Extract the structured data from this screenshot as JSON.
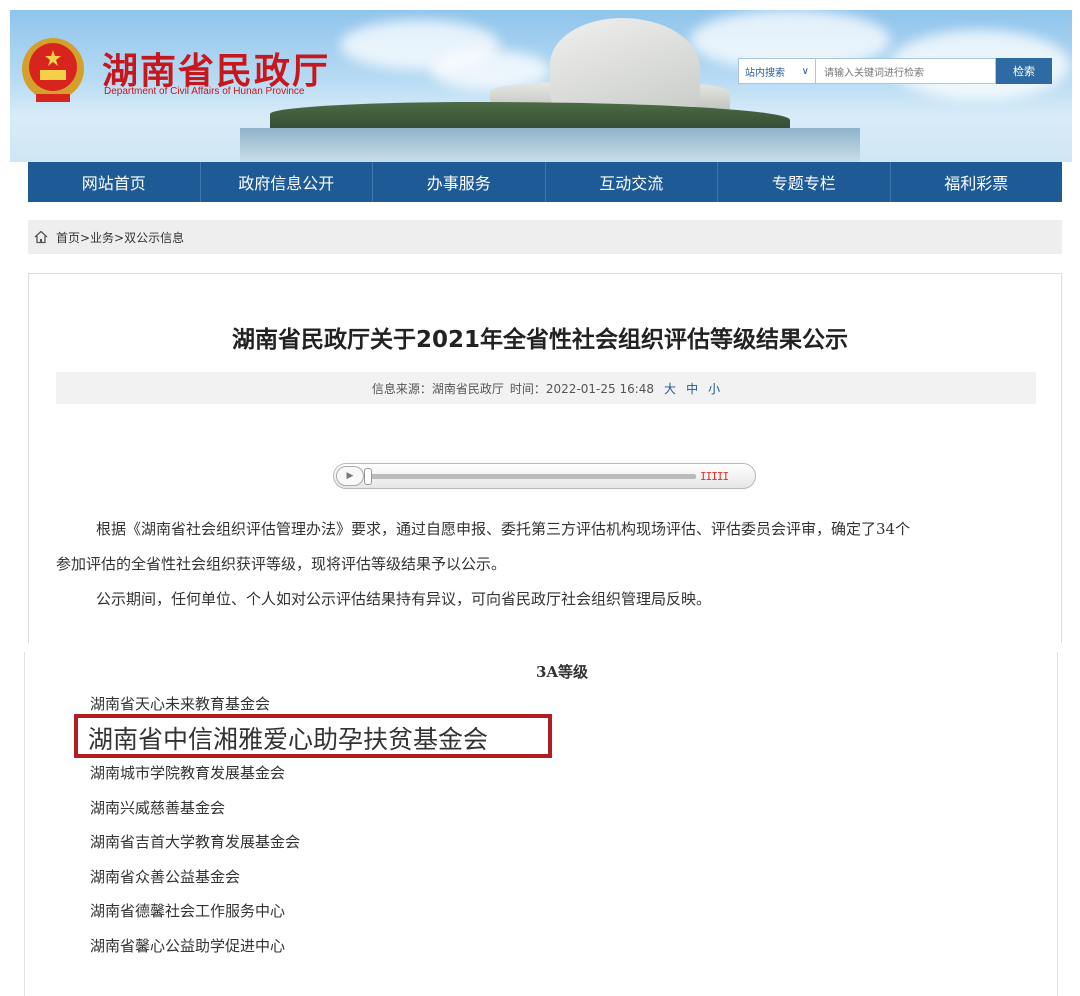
{
  "header": {
    "site_title": "湖南省民政厅",
    "site_subtitle": "Department of Civil Affairs of Hunan Province",
    "search": {
      "scope": "站内搜索",
      "placeholder": "请输入关键词进行检索",
      "button": "检索"
    }
  },
  "nav": {
    "items": [
      "网站首页",
      "政府信息公开",
      "办事服务",
      "互动交流",
      "专题专栏",
      "福利彩票"
    ]
  },
  "breadcrumb": "首页>业务>双公示信息",
  "article": {
    "title": "湖南省民政厅关于2021年全省性社会组织评估等级结果公示",
    "meta": {
      "source": "信息来源：湖南省民政厅",
      "time": "时间：2022-01-25 16:48",
      "size_large": "大",
      "size_medium": "中",
      "size_small": "小"
    },
    "paragraph1_line1": "根据《湖南省社会组织评估管理办法》要求，通过自愿申报、委托第三方评估机构现场评估、评估委员会评审，确定了34个",
    "paragraph1_line2": "参加评估的全省性社会组织获评等级，现将评估等级结果予以公示。",
    "paragraph2": "公示期间，任何单位、个人如对公示评估结果持有异议，可向省民政厅社会组织管理局反映。"
  },
  "list": {
    "grade": "3A等级",
    "orgs": [
      "湖南省天心未来教育基金会",
      "湖南省中信湘雅爱心助孕扶贫基金会",
      "湖南城市学院教育发展基金会",
      "湖南兴威慈善基金会",
      "湖南省吉首大学教育发展基金会",
      "湖南省众善公益基金会",
      "湖南省德馨社会工作服务中心",
      "湖南省馨心公益助学促进中心"
    ]
  },
  "colors": {
    "brand_red": "#c8161d",
    "nav_blue": "#1d5a96",
    "highlight_red": "#b11d21"
  }
}
